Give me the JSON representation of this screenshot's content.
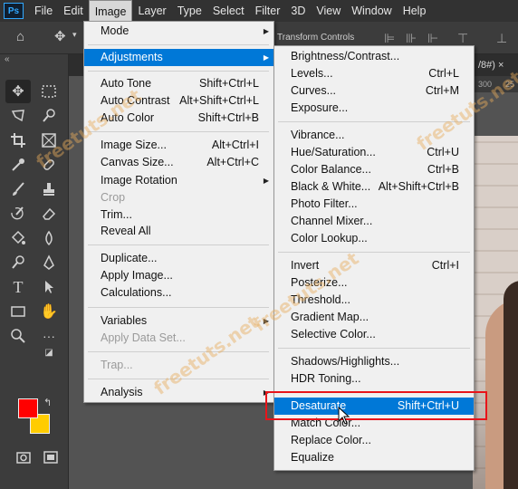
{
  "menubar": {
    "logo": "Ps",
    "items": [
      "File",
      "Edit",
      "Image",
      "Layer",
      "Type",
      "Select",
      "Filter",
      "3D",
      "View",
      "Window",
      "Help"
    ]
  },
  "optionsbar": {
    "transform_label": "Transform Controls"
  },
  "document": {
    "tab_label": "/8#) ×",
    "ruler_ticks": [
      "300",
      "25"
    ]
  },
  "image_menu": {
    "items": [
      {
        "label": "Mode",
        "shortcut": "",
        "submenu": true
      },
      {
        "label": "Adjustments",
        "shortcut": "",
        "submenu": true,
        "highlighted": true
      },
      {
        "label": "Auto Tone",
        "shortcut": "Shift+Ctrl+L"
      },
      {
        "label": "Auto Contrast",
        "shortcut": "Alt+Shift+Ctrl+L"
      },
      {
        "label": "Auto Color",
        "shortcut": "Shift+Ctrl+B"
      },
      {
        "label": "Image Size...",
        "shortcut": "Alt+Ctrl+I"
      },
      {
        "label": "Canvas Size...",
        "shortcut": "Alt+Ctrl+C"
      },
      {
        "label": "Image Rotation",
        "shortcut": "",
        "submenu": true
      },
      {
        "label": "Crop",
        "shortcut": "",
        "disabled": true
      },
      {
        "label": "Trim...",
        "shortcut": ""
      },
      {
        "label": "Reveal All",
        "shortcut": ""
      },
      {
        "label": "Duplicate...",
        "shortcut": ""
      },
      {
        "label": "Apply Image...",
        "shortcut": ""
      },
      {
        "label": "Calculations...",
        "shortcut": ""
      },
      {
        "label": "Variables",
        "shortcut": "",
        "submenu": true
      },
      {
        "label": "Apply Data Set...",
        "shortcut": "",
        "disabled": true
      },
      {
        "label": "Trap...",
        "shortcut": "",
        "disabled": true
      },
      {
        "label": "Analysis",
        "shortcut": "",
        "submenu": true
      }
    ]
  },
  "adjustments_menu": {
    "items": [
      {
        "label": "Brightness/Contrast...",
        "shortcut": ""
      },
      {
        "label": "Levels...",
        "shortcut": "Ctrl+L"
      },
      {
        "label": "Curves...",
        "shortcut": "Ctrl+M"
      },
      {
        "label": "Exposure...",
        "shortcut": ""
      },
      {
        "label": "Vibrance...",
        "shortcut": ""
      },
      {
        "label": "Hue/Saturation...",
        "shortcut": "Ctrl+U"
      },
      {
        "label": "Color Balance...",
        "shortcut": "Ctrl+B"
      },
      {
        "label": "Black & White...",
        "shortcut": "Alt+Shift+Ctrl+B"
      },
      {
        "label": "Photo Filter...",
        "shortcut": ""
      },
      {
        "label": "Channel Mixer...",
        "shortcut": ""
      },
      {
        "label": "Color Lookup...",
        "shortcut": ""
      },
      {
        "label": "Invert",
        "shortcut": "Ctrl+I"
      },
      {
        "label": "Posterize...",
        "shortcut": ""
      },
      {
        "label": "Threshold...",
        "shortcut": ""
      },
      {
        "label": "Gradient Map...",
        "shortcut": ""
      },
      {
        "label": "Selective Color...",
        "shortcut": ""
      },
      {
        "label": "Shadows/Highlights...",
        "shortcut": ""
      },
      {
        "label": "HDR Toning...",
        "shortcut": ""
      },
      {
        "label": "Desaturate",
        "shortcut": "Shift+Ctrl+U",
        "highlighted": true
      },
      {
        "label": "Match Color...",
        "shortcut": ""
      },
      {
        "label": "Replace Color...",
        "shortcut": ""
      },
      {
        "label": "Equalize",
        "shortcut": ""
      }
    ]
  },
  "colors": {
    "foreground": "#ff0000",
    "background": "#ffcc00",
    "highlight": "#0078d7",
    "callout_box": "#e8141a"
  },
  "watermark": "freetuts.net"
}
